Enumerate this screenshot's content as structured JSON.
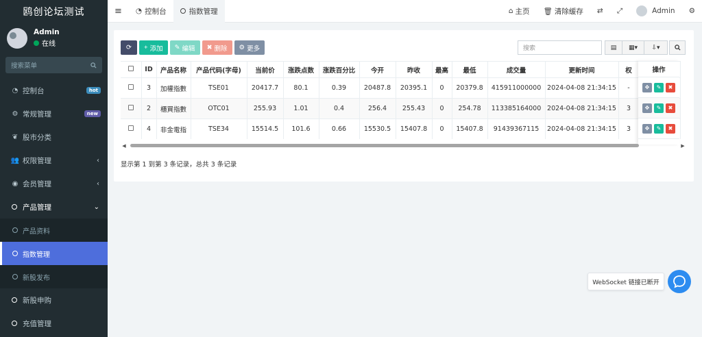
{
  "sidebar": {
    "brand": "鸥创论坛测试",
    "user_name": "Admin",
    "user_status": "在线",
    "search_placeholder": "搜索菜单",
    "items": [
      {
        "label": "控制台",
        "badge": "hot",
        "badge_color": "#3c8dbc",
        "icon": "dashboard-icon"
      },
      {
        "label": "常规管理",
        "badge": "new",
        "badge_color": "#605ca8",
        "icon": "cogs-icon"
      },
      {
        "label": "股市分类",
        "icon": "leaf-icon"
      },
      {
        "label": "权限管理",
        "icon": "users-icon"
      },
      {
        "label": "会员管理",
        "icon": "user-circle-icon"
      },
      {
        "label": "产品管理",
        "icon": "circle-icon"
      }
    ],
    "submenu": [
      {
        "label": "产品资料"
      },
      {
        "label": "指数管理"
      },
      {
        "label": "新股发布"
      }
    ],
    "after_items": [
      {
        "label": "新股申购"
      },
      {
        "label": "充值管理"
      }
    ]
  },
  "topbar": {
    "tab_dashboard": "控制台",
    "tab_index": "指数管理",
    "home": "主页",
    "clear_cache": "清除缓存",
    "user": "Admin"
  },
  "toolbar": {
    "add": "添加",
    "edit": "编辑",
    "delete": "删除",
    "more": "更多",
    "search_placeholder": "搜索"
  },
  "table": {
    "headers": [
      "ID",
      "产品名称",
      "产品代码(字母)",
      "当前价",
      "涨跌点数",
      "涨跌百分比",
      "今开",
      "昨收",
      "最高",
      "最低",
      "成交量",
      "更新时间",
      "权"
    ],
    "ops_header": "操作",
    "rows": [
      [
        "3",
        "加權指數",
        "TSE01",
        "20417.7",
        "80.1",
        "0.39",
        "20487.8",
        "20395.1",
        "0",
        "20379.8",
        "415911000000",
        "2024-04-08 21:34:15",
        "-"
      ],
      [
        "2",
        "櫃買指數",
        "OTC01",
        "255.93",
        "1.01",
        "0.4",
        "256.4",
        "255.43",
        "0",
        "254.78",
        "113385164000",
        "2024-04-08 21:34:15",
        "3"
      ],
      [
        "4",
        "非金電指",
        "TSE34",
        "15514.5",
        "101.6",
        "0.66",
        "15530.5",
        "15407.8",
        "0",
        "15407.8",
        "91439367115",
        "2024-04-08 21:34:15",
        "3"
      ]
    ]
  },
  "footer": {
    "info": "显示第 1 到第 3 条记录，总共 3 条记录"
  },
  "websocket": {
    "message": "WebSocket 链接已断开"
  }
}
